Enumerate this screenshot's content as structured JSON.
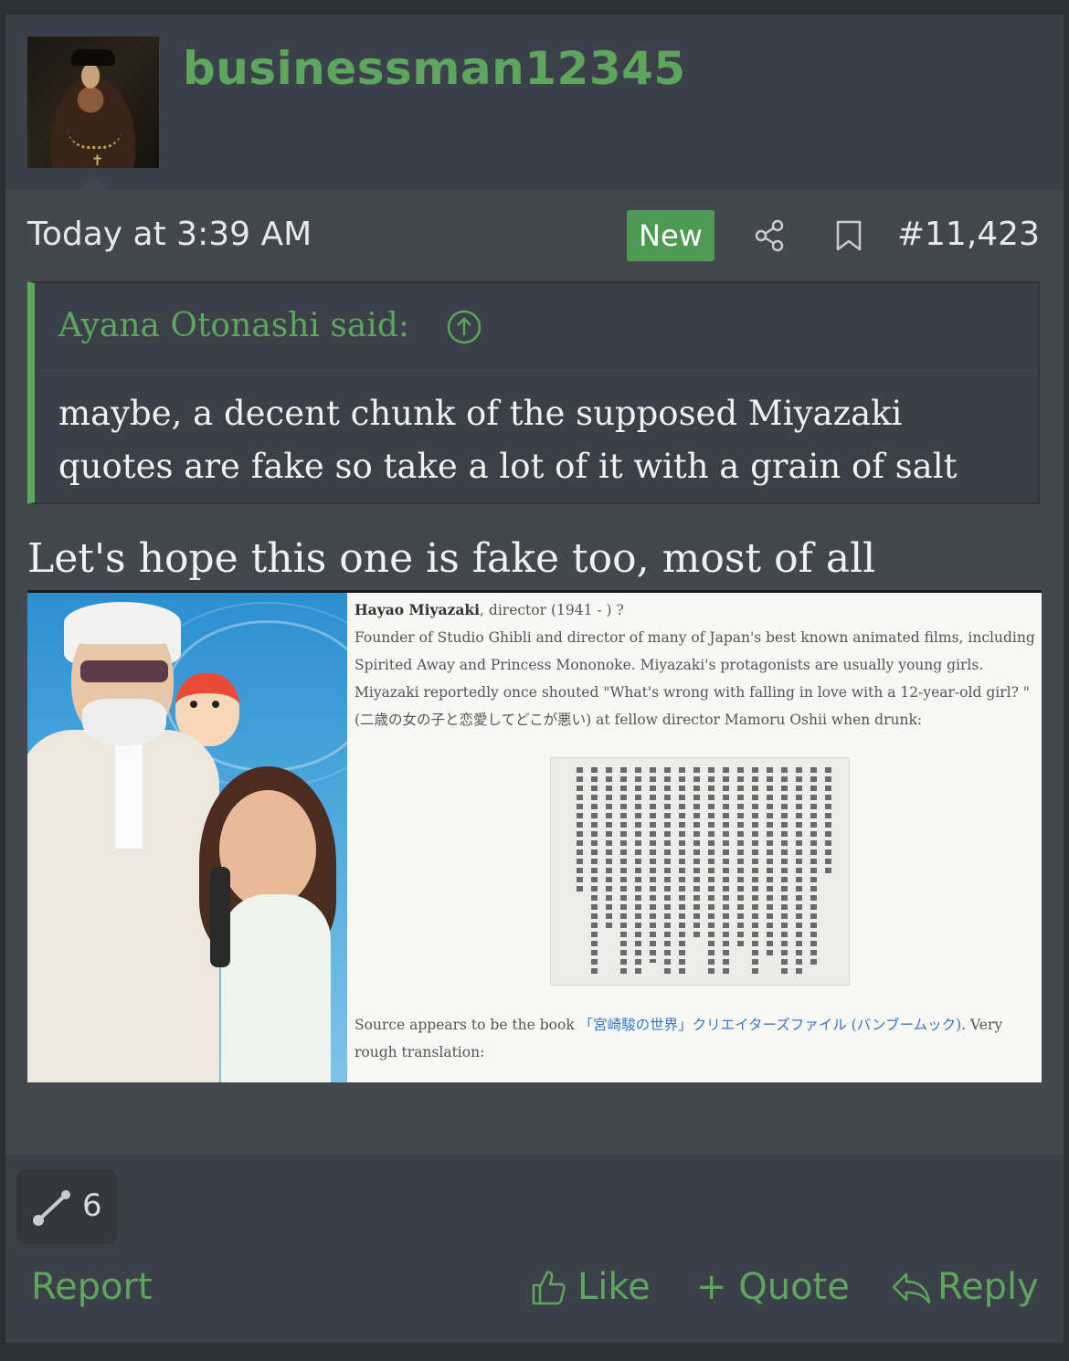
{
  "user": {
    "name": "businessman12345",
    "avatar_icon": "portrait-avatar"
  },
  "post": {
    "timestamp": "Today at 3:39 AM",
    "badge": "New",
    "number": "#11,423",
    "quote": {
      "author": "Ayana Otonashi said:",
      "text": "maybe, a decent chunk of the supposed Miyazaki quotes are fake so take a lot of it with a grain of salt"
    },
    "text": "Let's hope this one is fake too, most of all",
    "image": {
      "heading_name": "Hayao Miyazaki",
      "heading_rest": ", director (1941 - ) ?",
      "paragraph": "Founder of Studio Ghibli and director of many of Japan's best known animated films, including Spirited Away and Princess Mononoke. Miyazaki's protagonists are usually young girls. Miyazaki reportedly once shouted \"What's wrong with falling in love with a 12-year-old girl? \"(二歳の女の子と恋愛してどこが悪い) at fellow director Mamoru Oshii when drunk:",
      "source_pre": "Source appears to be the book ",
      "source_jp": "「宮崎駿の世界」クリエイターズファイル (バンブームック)",
      "source_post": ". Very rough translation:"
    }
  },
  "footer": {
    "reaction_count": "6",
    "report": "Report",
    "like": "Like",
    "quote": "+ Quote",
    "reply": "Reply"
  },
  "colors": {
    "accent": "#5ea55d",
    "badge_bg": "#4f9a52",
    "background": "#3c4149"
  }
}
